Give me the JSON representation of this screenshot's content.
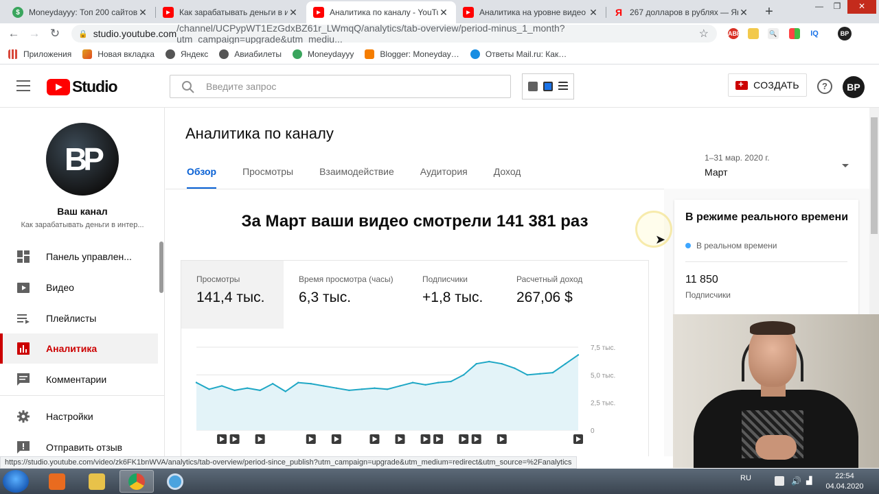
{
  "browser": {
    "tabs": [
      {
        "title": "Moneydayyy: Топ 200 сайтов д",
        "icon": "moneydayyy-icon",
        "color": "#3aa55d"
      },
      {
        "title": "Как зарабатывать деньги в инт",
        "icon": "youtube-icon",
        "color": "#ff0000"
      },
      {
        "title": "Аналитика по каналу - YouTub",
        "icon": "youtube-icon",
        "color": "#ff0000",
        "active": true
      },
      {
        "title": "Аналитика на уровне видео -",
        "icon": "youtube-icon",
        "color": "#ff0000"
      },
      {
        "title": "267 долларов в рублях — Янд",
        "icon": "yandex-icon",
        "color": "#ffffff"
      }
    ],
    "url_host": "studio.youtube.com",
    "url_path": "/channel/UCPypWT1EzGdxBZ61r_LWmqQ/analytics/tab-overview/period-minus_1_month?utm_campaign=upgrade&utm_mediu...",
    "bookmarks": [
      {
        "label": "Приложения",
        "icon": "apps-grid-icon",
        "color": "#d8483b"
      },
      {
        "label": "Новая вкладка",
        "icon": "windows-grid-icon",
        "color": "#e0a020"
      },
      {
        "label": "Яндекс",
        "icon": "globe-icon",
        "color": "#555555"
      },
      {
        "label": "Авиабилеты",
        "icon": "globe-icon",
        "color": "#555555"
      },
      {
        "label": "Moneydayyy",
        "icon": "moneydayyy-icon",
        "color": "#3aa55d"
      },
      {
        "label": "Blogger: Moneyday…",
        "icon": "blogger-icon",
        "color": "#f57d00"
      },
      {
        "label": "Ответы Mail.ru: Как…",
        "icon": "mailru-icon",
        "color": "#168de2"
      }
    ],
    "status_url": "https://studio.youtube.com/video/zk6FK1bnWVA/analytics/tab-overview/period-since_publish?utm_campaign=upgrade&utm_medium=redirect&utm_source=%2Fanalytics"
  },
  "header": {
    "logo_text": "Studio",
    "search_placeholder": "Введите запрос",
    "create_label": "СОЗДАТЬ",
    "help_glyph": "?",
    "avatar_letters": "BP"
  },
  "sidebar": {
    "channel_avatar_letters": "BP",
    "channel_title": "Ваш канал",
    "channel_subtitle": "Как зарабатывать деньги в интер...",
    "items": [
      {
        "label": "Панель управлен...",
        "icon": "dashboard-icon"
      },
      {
        "label": "Видео",
        "icon": "video-icon"
      },
      {
        "label": "Плейлисты",
        "icon": "playlist-icon"
      },
      {
        "label": "Аналитика",
        "icon": "analytics-icon",
        "active": true
      },
      {
        "label": "Комментарии",
        "icon": "comment-icon"
      },
      {
        "label": "Настройки",
        "icon": "gear-icon"
      },
      {
        "label": "Отправить отзыв",
        "icon": "feedback-icon"
      }
    ]
  },
  "main": {
    "title": "Аналитика по каналу",
    "tabs": [
      "Обзор",
      "Просмотры",
      "Взаимодействие",
      "Аудитория",
      "Доход"
    ],
    "period_range": "1–31 мар. 2020 г.",
    "period_value": "Март",
    "headline": "За Март ваши видео смотрели 141 381 раз",
    "metrics": [
      {
        "label": "Просмотры",
        "value": "141,4 тыс."
      },
      {
        "label": "Время просмотра (часы)",
        "value": "6,3 тыс."
      },
      {
        "label": "Подписчики",
        "value": "+1,8 тыс."
      },
      {
        "label": "Расчетный доход",
        "value": "267,06 $"
      }
    ]
  },
  "realtime": {
    "title": "В режиме реального времени",
    "live_label": "В реальном времени",
    "subscribers": "11 850",
    "subscribers_label": "Подписчики"
  },
  "chart_data": {
    "type": "area",
    "x": [
      1,
      2,
      3,
      4,
      5,
      6,
      7,
      8,
      9,
      10,
      11,
      12,
      13,
      14,
      15,
      16,
      17,
      18,
      19,
      20,
      21,
      22,
      23,
      24,
      25,
      26,
      27,
      28,
      29,
      30,
      31
    ],
    "series": [
      {
        "values": [
          4300,
          3700,
          4000,
          3600,
          3800,
          3600,
          4200,
          3500,
          4300,
          4200,
          4000,
          3800,
          3600,
          3700,
          3800,
          3700,
          4000,
          4300,
          4100,
          4300,
          4400,
          5000,
          6000,
          6200,
          6000,
          5600,
          5000,
          5100,
          5200,
          6000,
          6800
        ]
      }
    ],
    "y_ticks": [
      "7,5 тыс.",
      "5,0 тыс.",
      "2,5 тыс.",
      "0"
    ],
    "ylim": [
      0,
      7500
    ],
    "video_markers_days": [
      3,
      4,
      6,
      10,
      12,
      15,
      17,
      19,
      20,
      22,
      23,
      25,
      31
    ],
    "colors": {
      "line": "#1ea7c5",
      "fill": "#e3f3f8",
      "grid": "#e5e5e5"
    }
  },
  "taskbar": {
    "apps": [
      {
        "icon": "media-player-icon",
        "color": "#e96b1f"
      },
      {
        "icon": "file-explorer-icon",
        "color": "#e8c24a"
      },
      {
        "icon": "chrome-icon",
        "color": "#dd4b39",
        "active": true
      },
      {
        "icon": "app-circle-icon",
        "color": "#4aa3df"
      }
    ],
    "lang": "RU",
    "time": "22:54",
    "date": "04.04.2020"
  }
}
